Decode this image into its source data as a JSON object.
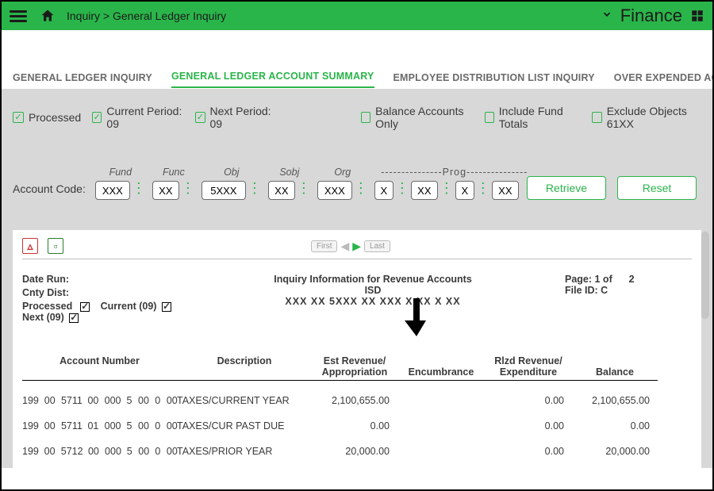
{
  "topbar": {
    "breadcrumb": "Inquiry > General Ledger Inquiry",
    "module": "Finance"
  },
  "tabs": [
    {
      "label": "GENERAL LEDGER INQUIRY",
      "active": false
    },
    {
      "label": "GENERAL LEDGER ACCOUNT SUMMARY",
      "active": true
    },
    {
      "label": "EMPLOYEE DISTRIBUTION LIST INQUIRY",
      "active": false
    },
    {
      "label": "OVER EXPENDED ACCOUNT SUMMARY",
      "active": false
    }
  ],
  "filters": {
    "processed": {
      "label": "Processed",
      "checked": true
    },
    "current": {
      "label": "Current Period: 09",
      "checked": true
    },
    "next": {
      "label": "Next Period: 09",
      "checked": true
    },
    "balance": {
      "label": "Balance Accounts Only",
      "checked": false
    },
    "fundtot": {
      "label": "Include Fund Totals",
      "checked": false
    },
    "excl61": {
      "label": "Exclude Objects 61XX",
      "checked": false
    }
  },
  "account": {
    "label": "Account Code:",
    "headers": {
      "fund": "Fund",
      "func": "Func",
      "obj": "Obj",
      "sobj": "Sobj",
      "org": "Org",
      "prog": "---------------Prog---------------"
    },
    "values": {
      "fund": "XXX",
      "func": "XX",
      "obj": "5XXX",
      "sobj": "XX",
      "org": "XXX",
      "p1": "X",
      "p2": "XX",
      "p3": "X",
      "p4": "XX"
    }
  },
  "buttons": {
    "retrieve": "Retrieve",
    "reset": "Reset"
  },
  "report": {
    "nav": {
      "first": "First",
      "last": "Last"
    },
    "title": "Inquiry Information for Revenue Accounts",
    "subtitle": "ISD",
    "mask": "XXX  XX  5XXX  XX  XXX  X  XX  X  XX",
    "meta": {
      "daterun": "Date Run:",
      "cntydist": "Cnty Dist:",
      "processed": "Processed",
      "current": "Current  (09)",
      "next": "Next  (09)",
      "page": "Page: 1 of",
      "pagetotal": "2",
      "fileid": "File ID: C"
    },
    "columns": {
      "acct": "Account Number",
      "desc": "Description",
      "est_l1": "Est Revenue/",
      "est_l2": "Appropriation",
      "enc": "Encumbrance",
      "rlz_l1": "Rlzd Revenue/",
      "rlz_l2": "Expenditure",
      "bal": "Balance"
    },
    "rows": [
      {
        "acct": [
          "199",
          "00",
          "5711",
          "00",
          "000",
          "5",
          "00",
          "0",
          "00"
        ],
        "desc": "TAXES/CURRENT YEAR",
        "est": "2,100,655.00",
        "enc": "",
        "rlz": "0.00",
        "bal": "2,100,655.00"
      },
      {
        "acct": [
          "199",
          "00",
          "5711",
          "01",
          "000",
          "5",
          "00",
          "0",
          "00"
        ],
        "desc": "TAXES/CUR PAST DUE",
        "est": "0.00",
        "enc": "",
        "rlz": "0.00",
        "bal": "0.00"
      },
      {
        "acct": [
          "199",
          "00",
          "5712",
          "00",
          "000",
          "5",
          "00",
          "0",
          "00"
        ],
        "desc": "TAXES/PRIOR YEAR",
        "est": "20,000.00",
        "enc": "",
        "rlz": "0.00",
        "bal": "20,000.00"
      }
    ]
  }
}
